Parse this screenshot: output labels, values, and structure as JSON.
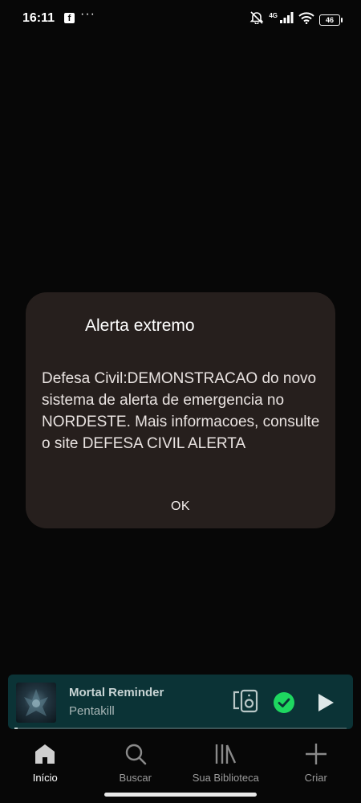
{
  "status_bar": {
    "time": "16:11",
    "network": "4G",
    "battery": "46"
  },
  "dialog": {
    "title": "Alerta extremo",
    "body": "Defesa Civil:DEMONSTRACAO do novo sistema de alerta de emergencia no NORDESTE. Mais informacoes, consulte o site DEFESA CIVIL ALERTA",
    "ok_label": "OK"
  },
  "mini_player": {
    "title": "Mortal Reminder",
    "artist": "Pentakill",
    "progress": 0.01,
    "accent": "#1ed760",
    "background": "#0b3336"
  },
  "nav": {
    "items": [
      {
        "label": "Início",
        "icon": "home-icon",
        "active": true
      },
      {
        "label": "Buscar",
        "icon": "search-icon",
        "active": false
      },
      {
        "label": "Sua Biblioteca",
        "icon": "library-icon",
        "active": false
      },
      {
        "label": "Criar",
        "icon": "plus-icon",
        "active": false
      }
    ]
  }
}
